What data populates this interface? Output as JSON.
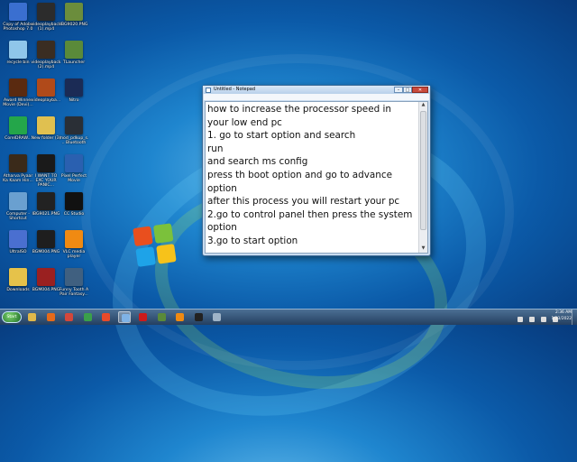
{
  "desktop": {
    "icons": [
      {
        "label": "Copy of Adobe Photoshop 7.0",
        "color": "#3a6fd0"
      },
      {
        "label": "videoplayback (1).mp4",
        "color": "#2c2c2c"
      },
      {
        "label": "IBG9020.PNG",
        "color": "#6b8d3c"
      },
      {
        "label": "recycle bin",
        "color": "#8fc6ea"
      },
      {
        "label": "videoplayback (2).mp4",
        "color": "#3a2d22"
      },
      {
        "label": "TLauncher",
        "color": "#5a8a3a"
      },
      {
        "label": "Award Winner Movie (Devi)...",
        "color": "#5a2a10"
      },
      {
        "label": "videoplayba...",
        "color": "#b04a1a"
      },
      {
        "label": "Nitro",
        "color": "#1b2b55"
      },
      {
        "label": "CorelDRAW...",
        "color": "#24a64a"
      },
      {
        "label": "New folder (3)",
        "color": "#e0c050"
      },
      {
        "label": "mod_pdkup_s... Bluetooth",
        "color": "#2a2f36"
      },
      {
        "label": "Atharva Pyaar Ka Kaam Hin...",
        "color": "#3a2a1a"
      },
      {
        "label": "I WANT TO EXC YOUR PANIC...",
        "color": "#1a1a1a"
      },
      {
        "label": "Pixel Perfect Movie",
        "color": "#2a60b0"
      },
      {
        "label": "Computer - Shortcut",
        "color": "#6aa0d0"
      },
      {
        "label": "IBG9021.PNG",
        "color": "#222"
      },
      {
        "label": "CC Studio",
        "color": "#111"
      },
      {
        "label": "UltraISO",
        "color": "#4a6fd0"
      },
      {
        "label": "BGM004.PNG",
        "color": "#1e1e1e"
      },
      {
        "label": "VLC media player",
        "color": "#f08a12"
      },
      {
        "label": "Downloads",
        "color": "#e6c24a"
      },
      {
        "label": "BGM004.PNG",
        "color": "#9a2020"
      },
      {
        "label": "Funny Tooth A Pair Fantasy...",
        "color": "#406080"
      }
    ]
  },
  "notepad": {
    "title": "Untitled - Notepad",
    "menu": [
      "File",
      "Edit",
      "Format",
      "View",
      "Help"
    ],
    "buttons": {
      "minimize": "–",
      "maximize": "□",
      "close": "✕"
    },
    "lines": [
      "how to increase the processor speed in",
      "your low end pc",
      "1. go to start option and search",
      "run",
      "and search ms config",
      "press th boot option and go to advance",
      "option",
      "after this process you will restart your pc",
      "2.go to control panel then press the system",
      "option",
      "3.go to start option"
    ]
  },
  "taskbar": {
    "start_label": "Start",
    "items": [
      {
        "name": "explorer",
        "color": "#e0b84a"
      },
      {
        "name": "media-player",
        "color": "#e66a1a"
      },
      {
        "name": "chrome",
        "color": "#d4473b"
      },
      {
        "name": "chrome-2",
        "color": "#3aa04a"
      },
      {
        "name": "paint",
        "color": "#e84a2a"
      },
      {
        "name": "notepad",
        "color": "#7fb3e6",
        "active": true
      },
      {
        "name": "opera",
        "color": "#cc1b1b"
      },
      {
        "name": "minecraft",
        "color": "#5a8a3a"
      },
      {
        "name": "blender",
        "color": "#f08a12"
      },
      {
        "name": "app-dark",
        "color": "#222"
      },
      {
        "name": "settings",
        "color": "#9fb4c8"
      }
    ],
    "clock_time": "2:36 AM",
    "clock_date": "1/23/2022"
  }
}
